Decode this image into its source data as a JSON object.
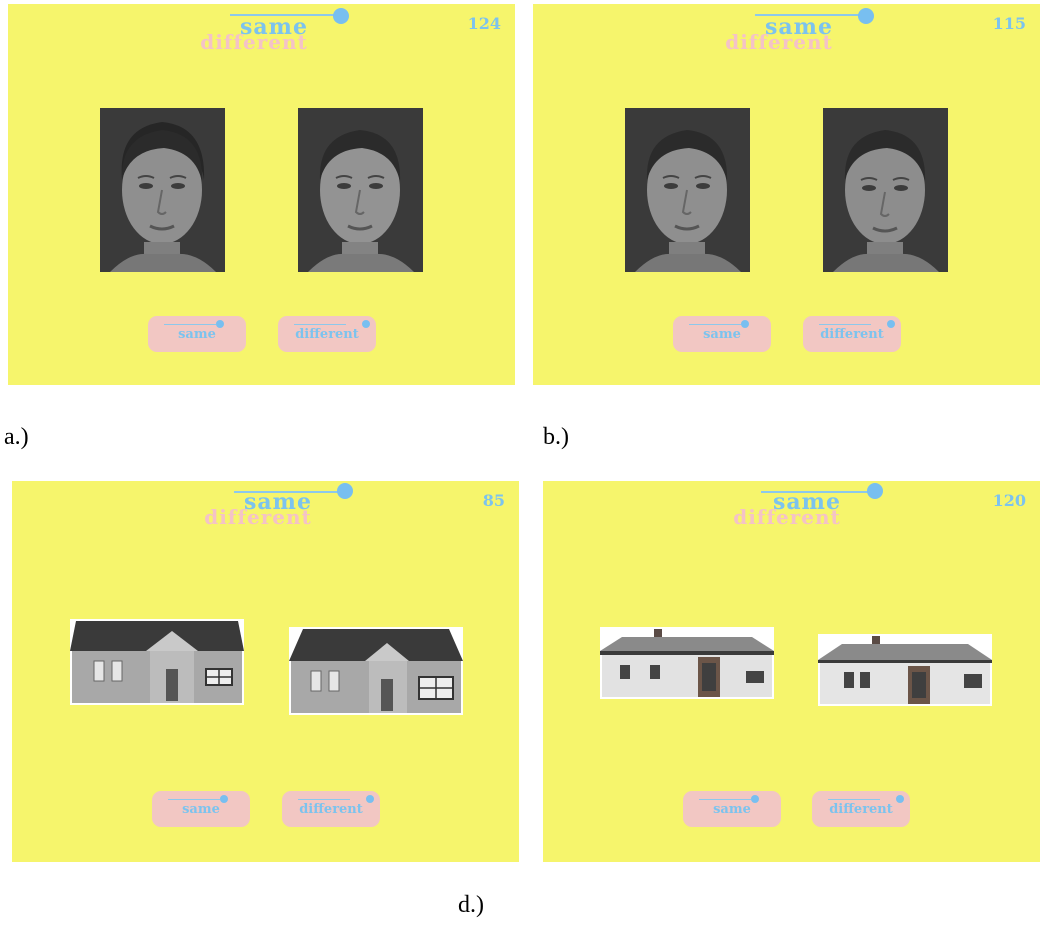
{
  "panels": [
    {
      "id": "a",
      "title_same": "same",
      "title_different": "different",
      "counter": "124",
      "stimulus": "face",
      "buttons": {
        "same": "same",
        "different": "different"
      }
    },
    {
      "id": "b",
      "title_same": "same",
      "title_different": "different",
      "counter": "115",
      "stimulus": "face",
      "buttons": {
        "same": "same",
        "different": "different"
      }
    },
    {
      "id": "c",
      "title_same": "same",
      "title_different": "different",
      "counter": "85",
      "stimulus": "house-gable",
      "buttons": {
        "same": "same",
        "different": "different"
      }
    },
    {
      "id": "d",
      "title_same": "same",
      "title_different": "different",
      "counter": "120",
      "stimulus": "house-hip",
      "buttons": {
        "same": "same",
        "different": "different"
      }
    }
  ],
  "captions": {
    "a": "a.)",
    "b": "b.)",
    "d": "d.)"
  },
  "colors": {
    "background": "#f6f56c",
    "accent_blue": "#7cc3ee",
    "accent_pink": "#f2c7c3"
  }
}
